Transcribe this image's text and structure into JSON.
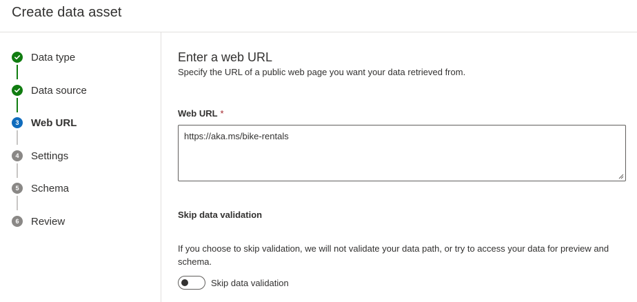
{
  "header": {
    "title": "Create data asset"
  },
  "steps": [
    {
      "label": "Data type",
      "status": "done",
      "number": "1"
    },
    {
      "label": "Data source",
      "status": "done",
      "number": "2"
    },
    {
      "label": "Web URL",
      "status": "active",
      "number": "3"
    },
    {
      "label": "Settings",
      "status": "todo",
      "number": "4"
    },
    {
      "label": "Schema",
      "status": "todo",
      "number": "5"
    },
    {
      "label": "Review",
      "status": "todo",
      "number": "6"
    }
  ],
  "main": {
    "title": "Enter a web URL",
    "description": "Specify the URL of a public web page you want your data retrieved from.",
    "web_url_label": "Web URL",
    "required_marker": "*",
    "web_url_value": "https://aka.ms/bike-rentals",
    "skip_heading": "Skip data validation",
    "skip_description": "If you choose to skip validation, we will not validate your data path, or try to access your data for preview and schema.",
    "toggle_label": "Skip data validation",
    "toggle_on": false
  },
  "colors": {
    "done": "#107c10",
    "active": "#0f6cbd",
    "todo": "#8a8886",
    "required": "#a4262c"
  }
}
